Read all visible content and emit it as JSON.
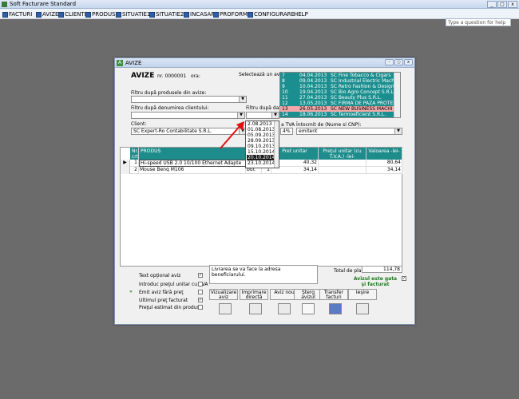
{
  "app": {
    "title": "Soft Facturare Standard"
  },
  "menu": {
    "items": [
      {
        "label": "FACTURI"
      },
      {
        "label": "AVIZE"
      },
      {
        "label": "CLIENTI"
      },
      {
        "label": "PRODUSE"
      },
      {
        "label": "SITUATIE1"
      },
      {
        "label": "SITUATIE2"
      },
      {
        "label": "INCASARI"
      },
      {
        "label": "PROFORME"
      },
      {
        "label": "CONFIGURARE"
      },
      {
        "label": "HELP"
      }
    ],
    "ask_placeholder": "Type a question for help"
  },
  "window": {
    "title": "AVIZE",
    "heading": "AVIZE",
    "nr_label": "nr. 0000001",
    "ora_label": "ora:",
    "select_label": "Selectează un aviz:",
    "filter_products_label": "Filtru după produsele din avize:",
    "filter_client_label": "Filtru după denumirea clientului:",
    "filter_date_label": "Filtru după dată:",
    "client_label": "Client:",
    "client_value": "SC Expert-Ro Contabilitate S.R.L.",
    "tva_label": "a TVA",
    "tva_value": "4%",
    "intocmit_label": "Întocmit de (Nume si CNP):",
    "intocmit_value": "emitent"
  },
  "aviz_list": [
    {
      "nr": "7",
      "date": "04.04.2013",
      "client": "SC Fine Tobacco & Cigars"
    },
    {
      "nr": "8",
      "date": "09.04.2013",
      "client": "SC Industrial Electric Machi"
    },
    {
      "nr": "9",
      "date": "10.04.2013",
      "client": "SC Retro Fashion & Design"
    },
    {
      "nr": "10",
      "date": "19.04.2013",
      "client": "SC Bio Agro Concept S.R.L."
    },
    {
      "nr": "11",
      "date": "27.04.2013",
      "client": "SC Beauty Plus S.R.L."
    },
    {
      "nr": "12",
      "date": "13.05.2013",
      "client": "SC FIRMA DE PAZA PROTE"
    },
    {
      "nr": "13",
      "date": "26.05.2013",
      "client": "SC NEW BUSINESS MACHI"
    },
    {
      "nr": "14",
      "date": "18.06.2013",
      "client": "SC Termoeficient S.R.L."
    }
  ],
  "date_dropdown": {
    "items": [
      "2.08.2013",
      "01.08.2013",
      "05.09.2013",
      "28.09.2013",
      "09.10.2013",
      "15.10.2014",
      "20.10.2014",
      "23.10.2014"
    ],
    "highlighted_index": 6
  },
  "grid": {
    "headers": {
      "nr": "Nr. crt",
      "produs": "PRODUS",
      "pret": "Pret unitar",
      "pret_tva": "Preţul unitar (cu T.V.A.) -lei-",
      "valoarea": "Valoarea -lei-"
    },
    "rows": [
      {
        "nr": "1",
        "produs": "Hi-speed USB 2.0 10/100 Ethernet Adapte",
        "um": "",
        "qty": "",
        "pret": "40,32",
        "valoare": "80,64"
      },
      {
        "nr": "2",
        "produs": "Mouse Benq M106",
        "um": "buc",
        "qty": "1",
        "pret": "34,14",
        "valoare": "34,14"
      }
    ]
  },
  "bottom": {
    "text_optional_label": "Text opţional aviz",
    "pret_tva_label": "Introduc preţul unitar cu TVA",
    "fara_pret_label": "Emit aviz fără preţ",
    "ultimul_pret_label": "Ultimul preţ facturat",
    "pret_estimat_label": "Preţul estimat din produse",
    "note_text": "Livrarea se va face la adresa beneficiarului.",
    "total_label": "Total de plată:",
    "total_value": "114,78",
    "gata_label": "Avizul este gata şi facturat",
    "buttons": {
      "vizualizare": "Vizualizare aviz",
      "imprimare": "Imprimare directă",
      "aviz_nou": "Aviz nou",
      "sterg": "Şterg avizul",
      "transfer": "Transfer facturi",
      "iesire": "Ieşire"
    }
  }
}
